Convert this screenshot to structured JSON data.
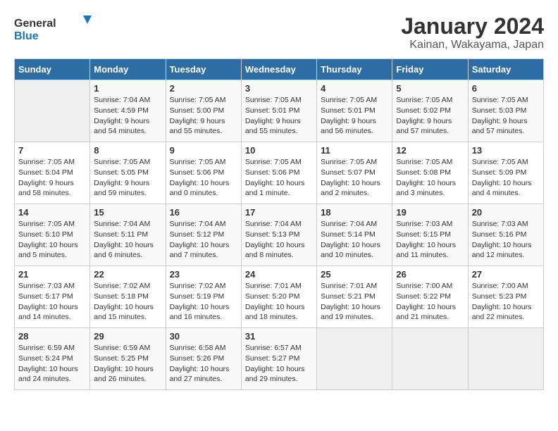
{
  "logo": {
    "text_general": "General",
    "text_blue": "Blue"
  },
  "title": "January 2024",
  "subtitle": "Kainan, Wakayama, Japan",
  "weekdays": [
    "Sunday",
    "Monday",
    "Tuesday",
    "Wednesday",
    "Thursday",
    "Friday",
    "Saturday"
  ],
  "weeks": [
    [
      {
        "day": "",
        "info": ""
      },
      {
        "day": "1",
        "info": "Sunrise: 7:04 AM\nSunset: 4:59 PM\nDaylight: 9 hours\nand 54 minutes."
      },
      {
        "day": "2",
        "info": "Sunrise: 7:05 AM\nSunset: 5:00 PM\nDaylight: 9 hours\nand 55 minutes."
      },
      {
        "day": "3",
        "info": "Sunrise: 7:05 AM\nSunset: 5:01 PM\nDaylight: 9 hours\nand 55 minutes."
      },
      {
        "day": "4",
        "info": "Sunrise: 7:05 AM\nSunset: 5:01 PM\nDaylight: 9 hours\nand 56 minutes."
      },
      {
        "day": "5",
        "info": "Sunrise: 7:05 AM\nSunset: 5:02 PM\nDaylight: 9 hours\nand 57 minutes."
      },
      {
        "day": "6",
        "info": "Sunrise: 7:05 AM\nSunset: 5:03 PM\nDaylight: 9 hours\nand 57 minutes."
      }
    ],
    [
      {
        "day": "7",
        "info": "Sunrise: 7:05 AM\nSunset: 5:04 PM\nDaylight: 9 hours\nand 58 minutes."
      },
      {
        "day": "8",
        "info": "Sunrise: 7:05 AM\nSunset: 5:05 PM\nDaylight: 9 hours\nand 59 minutes."
      },
      {
        "day": "9",
        "info": "Sunrise: 7:05 AM\nSunset: 5:06 PM\nDaylight: 10 hours\nand 0 minutes."
      },
      {
        "day": "10",
        "info": "Sunrise: 7:05 AM\nSunset: 5:06 PM\nDaylight: 10 hours\nand 1 minute."
      },
      {
        "day": "11",
        "info": "Sunrise: 7:05 AM\nSunset: 5:07 PM\nDaylight: 10 hours\nand 2 minutes."
      },
      {
        "day": "12",
        "info": "Sunrise: 7:05 AM\nSunset: 5:08 PM\nDaylight: 10 hours\nand 3 minutes."
      },
      {
        "day": "13",
        "info": "Sunrise: 7:05 AM\nSunset: 5:09 PM\nDaylight: 10 hours\nand 4 minutes."
      }
    ],
    [
      {
        "day": "14",
        "info": "Sunrise: 7:05 AM\nSunset: 5:10 PM\nDaylight: 10 hours\nand 5 minutes."
      },
      {
        "day": "15",
        "info": "Sunrise: 7:04 AM\nSunset: 5:11 PM\nDaylight: 10 hours\nand 6 minutes."
      },
      {
        "day": "16",
        "info": "Sunrise: 7:04 AM\nSunset: 5:12 PM\nDaylight: 10 hours\nand 7 minutes."
      },
      {
        "day": "17",
        "info": "Sunrise: 7:04 AM\nSunset: 5:13 PM\nDaylight: 10 hours\nand 8 minutes."
      },
      {
        "day": "18",
        "info": "Sunrise: 7:04 AM\nSunset: 5:14 PM\nDaylight: 10 hours\nand 10 minutes."
      },
      {
        "day": "19",
        "info": "Sunrise: 7:03 AM\nSunset: 5:15 PM\nDaylight: 10 hours\nand 11 minutes."
      },
      {
        "day": "20",
        "info": "Sunrise: 7:03 AM\nSunset: 5:16 PM\nDaylight: 10 hours\nand 12 minutes."
      }
    ],
    [
      {
        "day": "21",
        "info": "Sunrise: 7:03 AM\nSunset: 5:17 PM\nDaylight: 10 hours\nand 14 minutes."
      },
      {
        "day": "22",
        "info": "Sunrise: 7:02 AM\nSunset: 5:18 PM\nDaylight: 10 hours\nand 15 minutes."
      },
      {
        "day": "23",
        "info": "Sunrise: 7:02 AM\nSunset: 5:19 PM\nDaylight: 10 hours\nand 16 minutes."
      },
      {
        "day": "24",
        "info": "Sunrise: 7:01 AM\nSunset: 5:20 PM\nDaylight: 10 hours\nand 18 minutes."
      },
      {
        "day": "25",
        "info": "Sunrise: 7:01 AM\nSunset: 5:21 PM\nDaylight: 10 hours\nand 19 minutes."
      },
      {
        "day": "26",
        "info": "Sunrise: 7:00 AM\nSunset: 5:22 PM\nDaylight: 10 hours\nand 21 minutes."
      },
      {
        "day": "27",
        "info": "Sunrise: 7:00 AM\nSunset: 5:23 PM\nDaylight: 10 hours\nand 22 minutes."
      }
    ],
    [
      {
        "day": "28",
        "info": "Sunrise: 6:59 AM\nSunset: 5:24 PM\nDaylight: 10 hours\nand 24 minutes."
      },
      {
        "day": "29",
        "info": "Sunrise: 6:59 AM\nSunset: 5:25 PM\nDaylight: 10 hours\nand 26 minutes."
      },
      {
        "day": "30",
        "info": "Sunrise: 6:58 AM\nSunset: 5:26 PM\nDaylight: 10 hours\nand 27 minutes."
      },
      {
        "day": "31",
        "info": "Sunrise: 6:57 AM\nSunset: 5:27 PM\nDaylight: 10 hours\nand 29 minutes."
      },
      {
        "day": "",
        "info": ""
      },
      {
        "day": "",
        "info": ""
      },
      {
        "day": "",
        "info": ""
      }
    ]
  ]
}
